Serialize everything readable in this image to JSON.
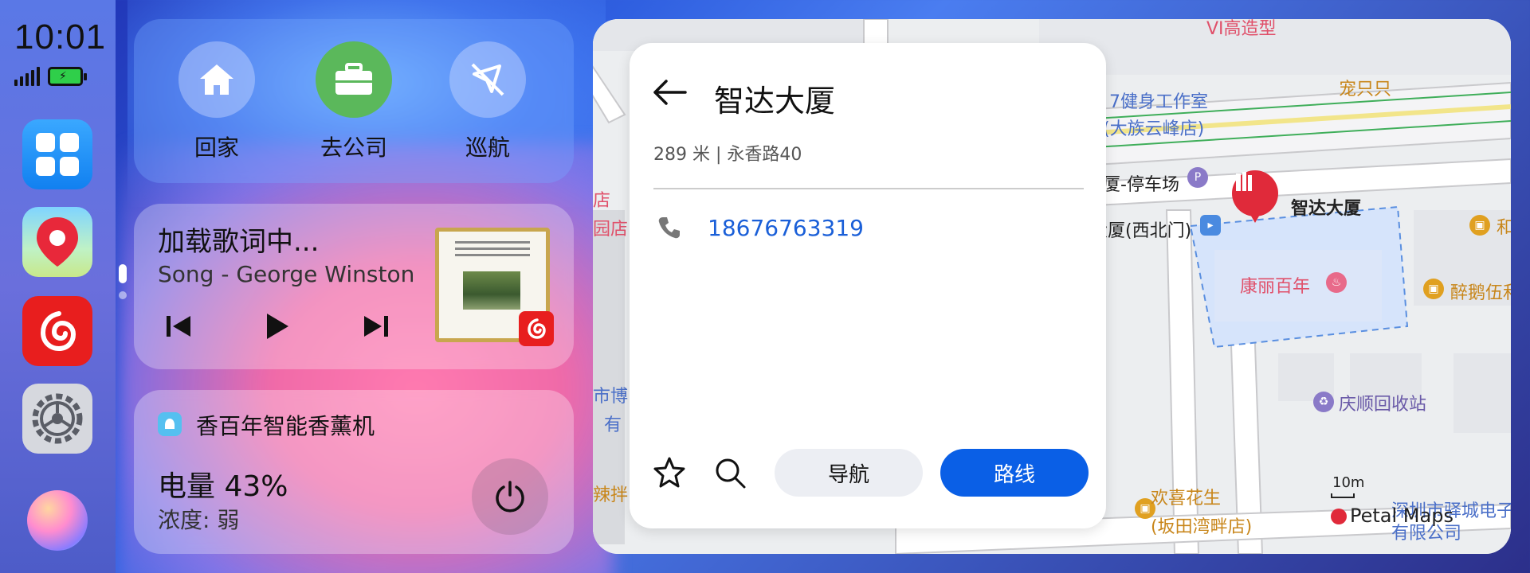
{
  "status": {
    "time": "10:01",
    "signal_icon": "signal-icon",
    "battery_icon": "battery-charging-icon"
  },
  "dock": {
    "apps": [
      {
        "name": "app-launcher",
        "icon": "grid-icon"
      },
      {
        "name": "petal-maps",
        "icon": "map-pin-icon"
      },
      {
        "name": "netease-music",
        "icon": "music-icon"
      },
      {
        "name": "settings",
        "icon": "gear-icon"
      },
      {
        "name": "voice-assistant",
        "icon": "assistant-orb-icon"
      }
    ]
  },
  "quick_actions": {
    "home_label": "回家",
    "work_label": "去公司",
    "cruise_label": "巡航"
  },
  "music": {
    "title": "加载歌词中...",
    "subtitle": "Song - George Winston"
  },
  "device": {
    "name": "香百年智能香薰机",
    "battery": "电量 43%",
    "density": "浓度: 弱"
  },
  "place": {
    "title": "智达大厦",
    "subtitle": "289 米 | 永香路40",
    "phone": "18676763319",
    "nav_label": "导航",
    "route_label": "路线"
  },
  "map": {
    "labels": {
      "fitness": "7健身工作室",
      "fitness_branch": "(大族云峰店)",
      "pet": "宠只只",
      "parking": "厦-停车场",
      "building_label": "智达大厦",
      "northwest_gate": "大厦(西北门)",
      "kangli": "康丽百年",
      "zuie": "醉鹅伍和",
      "recycle": "庆顺回收站",
      "huanxi": "欢喜花生",
      "huanxi_branch": "(坂田湾畔店)",
      "company_1": "深圳市驿城电子",
      "company_2": "有限公司",
      "left_1": "店",
      "left_2": "园店",
      "left_3": "市博",
      "left_4": "有",
      "left_5": "辣拌",
      "top": "VI高造型",
      "he": "和"
    },
    "scale": "10m",
    "brand": "Petal Maps",
    "colors": {
      "road": "#ffffff",
      "road_outline": "#c9c9cc",
      "main_road": "#f5e89a",
      "green_line": "#3fae5a",
      "highlight_area": "#d6e4fb",
      "pin": "#e02a3a"
    }
  },
  "colors": {
    "primary_button": "#0a5fe6",
    "link": "#1a5fd8",
    "work_green": "#5bb85b"
  }
}
